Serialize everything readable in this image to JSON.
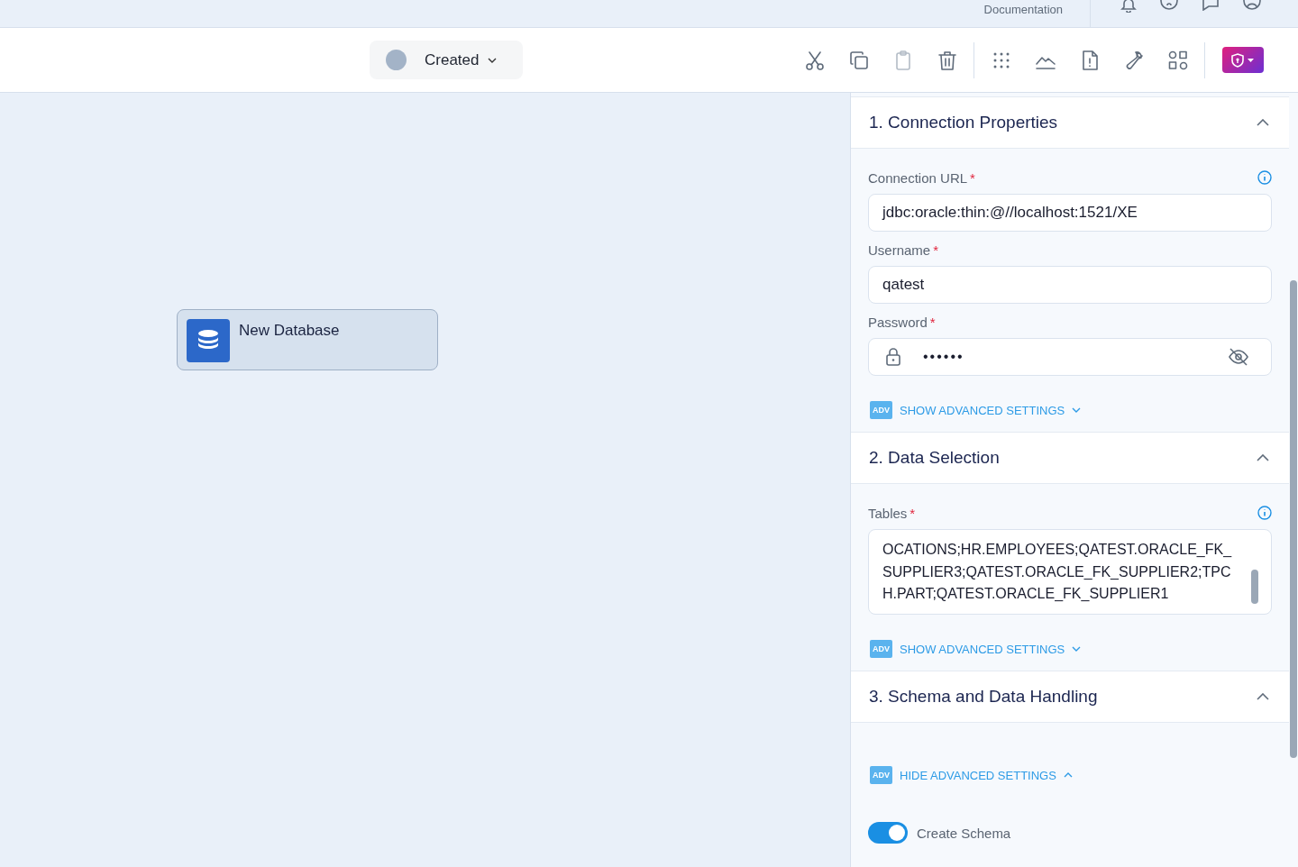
{
  "top_bar": {
    "link": "Documentation",
    "icons": [
      {
        "kind": "bell"
      },
      {
        "kind": "help"
      },
      {
        "kind": "chat"
      },
      {
        "kind": "user"
      }
    ]
  },
  "toolbar": {
    "status": {
      "label": "Created",
      "color": "#a3b3c7"
    },
    "tools": [
      {
        "kind": "cut",
        "disabled": false
      },
      {
        "kind": "copy",
        "disabled": false
      },
      {
        "kind": "paste",
        "disabled": true
      },
      {
        "kind": "delete",
        "disabled": false
      },
      {
        "kind": "sep"
      },
      {
        "kind": "grid",
        "disabled": false
      },
      {
        "kind": "chart",
        "disabled": false
      },
      {
        "kind": "file",
        "disabled": false
      },
      {
        "kind": "wrench",
        "disabled": false
      },
      {
        "kind": "apps",
        "disabled": false
      },
      {
        "kind": "sep"
      },
      {
        "kind": "shield",
        "disabled": false
      }
    ]
  },
  "canvas": {
    "node": {
      "title": "New Database"
    }
  },
  "panel": {
    "sections": [
      {
        "title": "1. Connection Properties",
        "expanded": true,
        "fields": [
          {
            "kind": "text",
            "label": "Connection URL",
            "required_mark": "*",
            "info": true,
            "value": "jdbc:oracle:thin:@//localhost:1521/XE"
          },
          {
            "kind": "text",
            "label": "Username",
            "required_mark": "*",
            "info": false,
            "value": "qatest"
          },
          {
            "kind": "password",
            "label": "Password",
            "required_mark": "*",
            "info": false,
            "value": "••••••"
          }
        ],
        "advanced": {
          "badge": "ADV",
          "label": "SHOW ADVANCED SETTINGS",
          "expanded": false
        }
      },
      {
        "title": "2. Data Selection",
        "expanded": true,
        "fields": [
          {
            "kind": "textarea",
            "label": "Tables",
            "required_mark": "*",
            "info": true,
            "value": "OCATIONS;HR.EMPLOYEES;QATEST.ORACLE_FK_SUPPLIER3;QATEST.ORACLE_FK_SUPPLIER2;TPCH.PART;QATEST.ORACLE_FK_SUPPLIER1"
          }
        ],
        "advanced": {
          "badge": "ADV",
          "label": "SHOW ADVANCED SETTINGS",
          "expanded": false
        }
      },
      {
        "title": "3. Schema and Data Handling",
        "expanded": true,
        "advanced": {
          "badge": "ADV",
          "label": "HIDE ADVANCED SETTINGS",
          "expanded": true
        },
        "toggles": [
          {
            "label": "Create Schema",
            "checked": true
          }
        ]
      }
    ]
  }
}
